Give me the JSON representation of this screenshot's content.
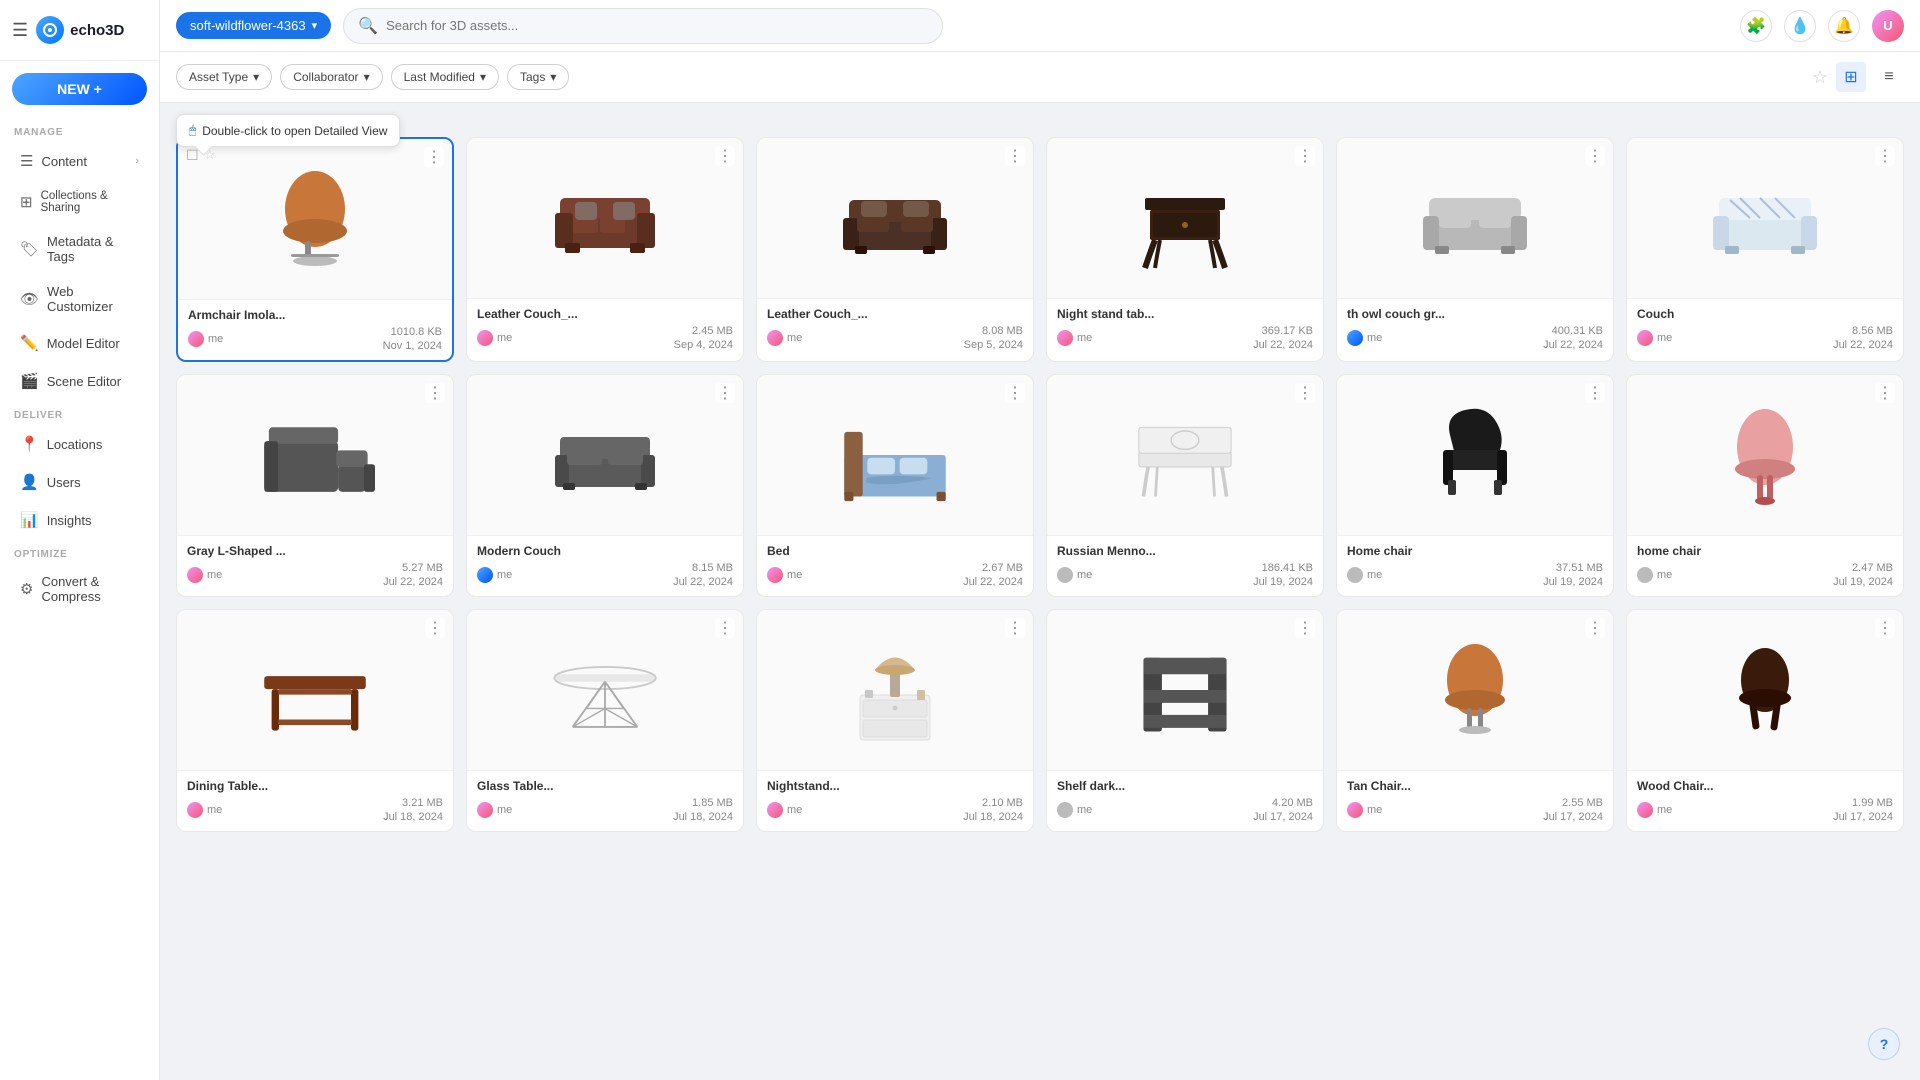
{
  "app": {
    "name": "echo3D",
    "logo_text": "echo3D"
  },
  "topbar": {
    "workspace": "soft-wildflower-4363",
    "search_placeholder": "Search for 3D assets...",
    "new_btn_label": "NEW +"
  },
  "sidebar": {
    "manage_label": "MANAGE",
    "deliver_label": "DELIVER",
    "optimize_label": "OPTIMIZE",
    "items_manage": [
      {
        "id": "content",
        "label": "Content",
        "icon": "☰",
        "has_chevron": true
      },
      {
        "id": "collections",
        "label": "Collections & Sharing",
        "icon": "⊞"
      },
      {
        "id": "metadata",
        "label": "Metadata & Tags",
        "icon": "🏷"
      },
      {
        "id": "web-customizer",
        "label": "Web Customizer",
        "icon": "👁"
      },
      {
        "id": "model-editor",
        "label": "Model Editor",
        "icon": "✏️"
      },
      {
        "id": "scene-editor",
        "label": "Scene Editor",
        "icon": "🎬"
      }
    ],
    "items_deliver": [
      {
        "id": "locations",
        "label": "Locations",
        "icon": "📍"
      },
      {
        "id": "users",
        "label": "Users",
        "icon": "👤"
      },
      {
        "id": "insights",
        "label": "Insights",
        "icon": "📊"
      }
    ],
    "items_optimize": [
      {
        "id": "convert",
        "label": "Convert & Compress",
        "icon": "⚙"
      }
    ]
  },
  "filters": {
    "asset_type": "Asset Type",
    "collaborator": "Collaborator",
    "last_modified": "Last Modified",
    "tags": "Tags"
  },
  "tooltip": {
    "text": "Double-click to open Detailed View"
  },
  "assets": [
    {
      "id": 1,
      "name": "Armchair Imola...",
      "size": "1010.8 KB",
      "date": "Nov 1, 2024",
      "owner": "me",
      "owner_color": "pink",
      "selected": true,
      "shape": "armchair"
    },
    {
      "id": 2,
      "name": "Leather Couch_...",
      "size": "2.45 MB",
      "date": "Sep 4, 2024",
      "owner": "me",
      "owner_color": "pink",
      "shape": "sofa-brown"
    },
    {
      "id": 3,
      "name": "Leather Couch_...",
      "size": "8.08 MB",
      "date": "Sep 5, 2024",
      "owner": "me",
      "owner_color": "pink",
      "shape": "sofa-brown2"
    },
    {
      "id": 4,
      "name": "Night stand tab...",
      "size": "369.17 KB",
      "date": "Jul 22, 2024",
      "owner": "me",
      "owner_color": "pink",
      "shape": "nightstand"
    },
    {
      "id": 5,
      "name": "th owl couch gr...",
      "size": "400.31 KB",
      "date": "Jul 22, 2024",
      "owner": "me",
      "owner_color": "blue",
      "shape": "sofa-gray"
    },
    {
      "id": 6,
      "name": "Couch",
      "size": "8.56 MB",
      "date": "Jul 22, 2024",
      "owner": "me",
      "owner_color": "pink",
      "shape": "sofa-patterned"
    },
    {
      "id": 7,
      "name": "Gray L-Shaped ...",
      "size": "5.27 MB",
      "date": "Jul 22, 2024",
      "owner": "me",
      "owner_color": "pink",
      "shape": "l-sofa"
    },
    {
      "id": 8,
      "name": "Modern Couch",
      "size": "8.15 MB",
      "date": "Jul 22, 2024",
      "owner": "me",
      "owner_color": "blue",
      "shape": "sofa-charcoal"
    },
    {
      "id": 9,
      "name": "Bed",
      "size": "2.67 MB",
      "date": "Jul 22, 2024",
      "owner": "me",
      "owner_color": "pink",
      "shape": "bed"
    },
    {
      "id": 10,
      "name": "Russian Menno...",
      "size": "186.41 KB",
      "date": "Jul 19, 2024",
      "owner": "me",
      "owner_color": "gray",
      "shape": "bench-white"
    },
    {
      "id": 11,
      "name": "Home chair",
      "size": "37.51 MB",
      "date": "Jul 19, 2024",
      "owner": "me",
      "owner_color": "gray",
      "shape": "chair-black"
    },
    {
      "id": 12,
      "name": "home chair",
      "size": "2.47 MB",
      "date": "Jul 19, 2024",
      "owner": "me",
      "owner_color": "gray",
      "shape": "chair-pink"
    },
    {
      "id": 13,
      "name": "Dining Table...",
      "size": "3.21 MB",
      "date": "Jul 18, 2024",
      "owner": "me",
      "owner_color": "pink",
      "shape": "table-brown"
    },
    {
      "id": 14,
      "name": "Glass Table...",
      "size": "1.85 MB",
      "date": "Jul 18, 2024",
      "owner": "me",
      "owner_color": "pink",
      "shape": "table-glass"
    },
    {
      "id": 15,
      "name": "Nightstand...",
      "size": "2.10 MB",
      "date": "Jul 18, 2024",
      "owner": "me",
      "owner_color": "pink",
      "shape": "nightstand-lamp"
    },
    {
      "id": 16,
      "name": "Shelf dark...",
      "size": "4.20 MB",
      "date": "Jul 17, 2024",
      "owner": "me",
      "owner_color": "gray",
      "shape": "shelf"
    },
    {
      "id": 17,
      "name": "Tan Chair...",
      "size": "2.55 MB",
      "date": "Jul 17, 2024",
      "owner": "me",
      "owner_color": "pink",
      "shape": "chair-tan"
    },
    {
      "id": 18,
      "name": "Wood Chair...",
      "size": "1.99 MB",
      "date": "Jul 17, 2024",
      "owner": "me",
      "owner_color": "pink",
      "shape": "chair-wood-dark"
    }
  ]
}
